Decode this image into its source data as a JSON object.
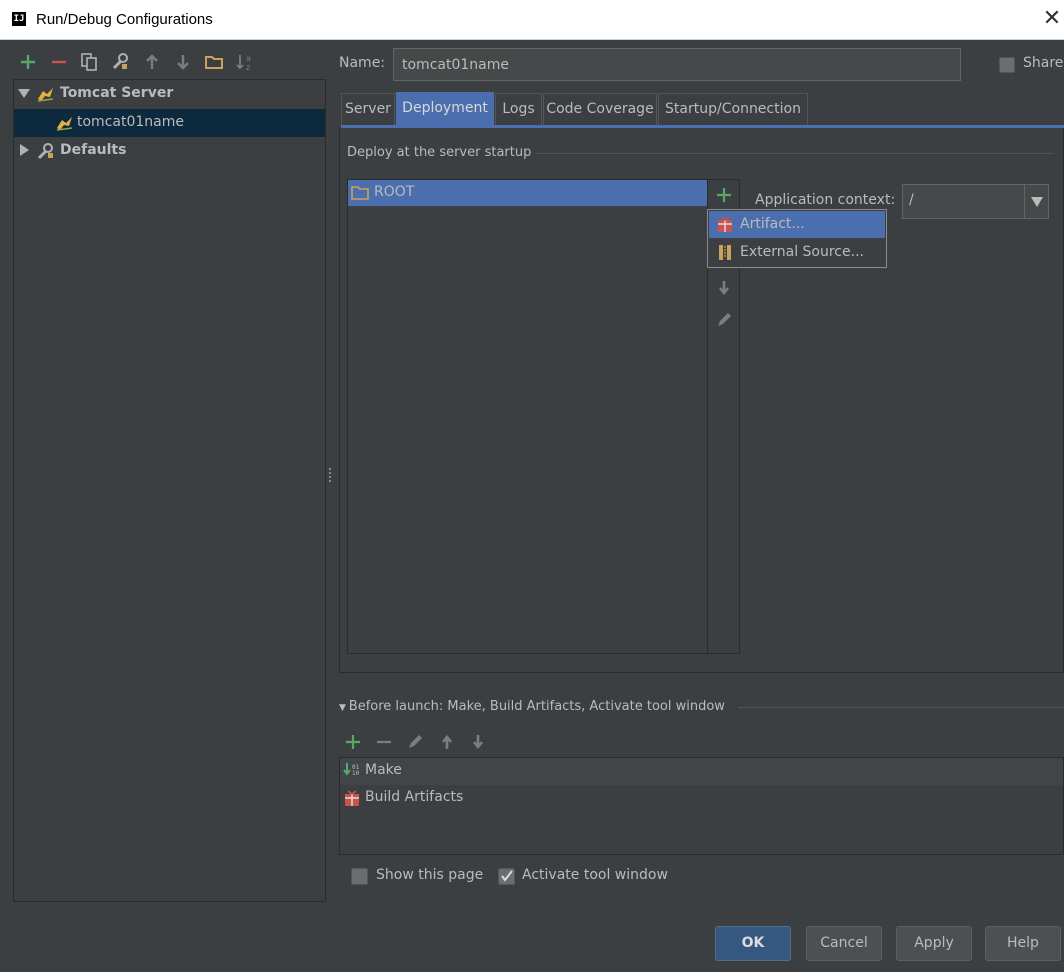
{
  "window": {
    "title": "Run/Debug Configurations",
    "app_icon": "IJ"
  },
  "tree": {
    "items": [
      {
        "label": "Tomcat Server",
        "icon": "tomcat-icon"
      },
      {
        "label": "tomcat01name",
        "icon": "tomcat-icon"
      },
      {
        "label": "Defaults",
        "icon": "wrench-icon"
      }
    ]
  },
  "name_field": {
    "label": "Name:",
    "value": "tomcat01name"
  },
  "share": {
    "label": "Share",
    "checked": false
  },
  "tabs": [
    {
      "label": "Server"
    },
    {
      "label": "Deployment",
      "active": true
    },
    {
      "label": "Logs"
    },
    {
      "label": "Code Coverage"
    },
    {
      "label": "Startup/Connection"
    }
  ],
  "deploy": {
    "section_title": "Deploy at the server startup",
    "items": [
      {
        "label": "ROOT"
      }
    ],
    "popup": [
      {
        "label": "Artifact..."
      },
      {
        "label": "External Source..."
      }
    ],
    "context_label": "Application context:",
    "context_value": "/"
  },
  "before_launch": {
    "header": "Before launch: Make, Build Artifacts, Activate tool window",
    "items": [
      {
        "label": "Make"
      },
      {
        "label": "Build Artifacts"
      }
    ],
    "show_page": {
      "label": "Show this page",
      "checked": false
    },
    "activate_tool": {
      "label": "Activate tool window",
      "checked": true
    }
  },
  "buttons": {
    "ok": "OK",
    "cancel": "Cancel",
    "apply": "Apply",
    "help": "Help"
  },
  "colors": {
    "background": "#3c3f41",
    "selection": "#4b6eaf",
    "tree_selection": "#0d293e",
    "add_green": "#59a869",
    "remove_red": "#c75450"
  }
}
